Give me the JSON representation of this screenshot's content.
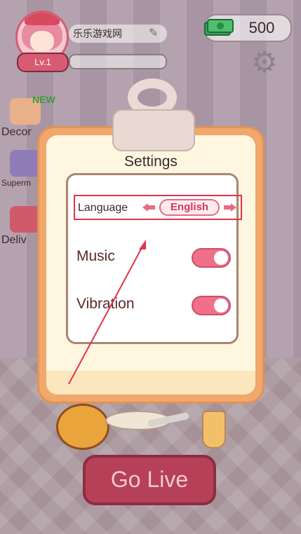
{
  "header": {
    "username": "乐乐游戏网",
    "level": "Lv.1",
    "currency_value": "500",
    "icons": [
      "avatar",
      "pencil-icon",
      "money-icon",
      "gear-icon"
    ]
  },
  "side_menu": {
    "items": [
      {
        "label": "Decor",
        "tag": "NEW"
      },
      {
        "label": "Superm"
      },
      {
        "label": "Deliv"
      }
    ]
  },
  "dialog": {
    "title": "Settings",
    "language": {
      "label": "Language",
      "value": "English"
    },
    "music": {
      "label": "Music",
      "enabled": true
    },
    "vibration": {
      "label": "Vibration",
      "enabled": true
    }
  },
  "actions": {
    "go_live_label": "Go Live"
  },
  "colors": {
    "accent_pink": "#f0708a",
    "dialog_orange": "#f0a86c",
    "highlight_red": "#e0344a"
  }
}
